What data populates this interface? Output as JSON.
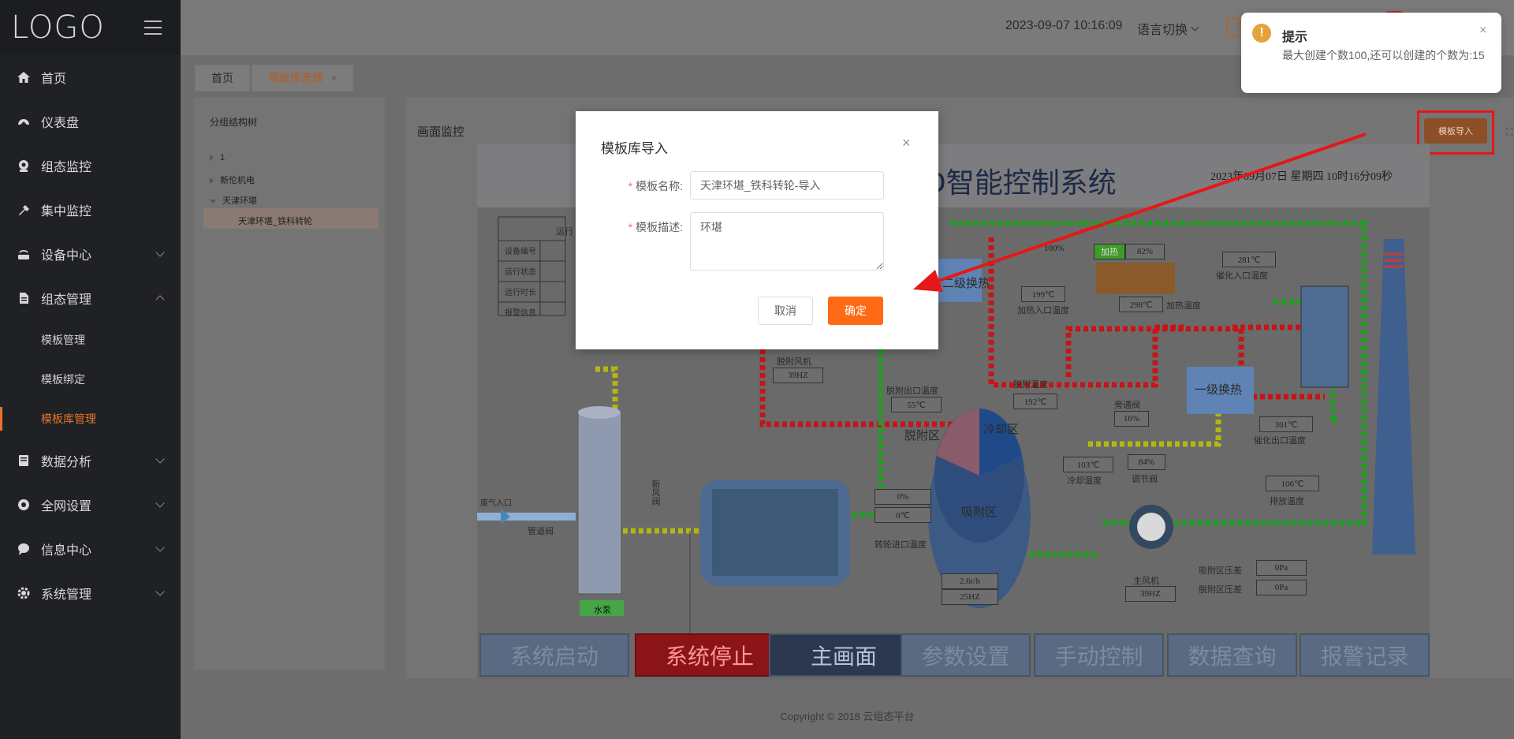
{
  "app": {
    "logo": "LOGO"
  },
  "header": {
    "datetime": "2023-09-07 10:16:09",
    "language_switch": "语言切换"
  },
  "sidebar": {
    "items": [
      {
        "label": "首页",
        "icon": "home-icon"
      },
      {
        "label": "仪表盘",
        "icon": "dashboard-icon"
      },
      {
        "label": "组态监控",
        "icon": "camera-icon"
      },
      {
        "label": "集中监控",
        "icon": "hammer-icon"
      },
      {
        "label": "设备中心",
        "icon": "router-icon"
      },
      {
        "label": "组态管理",
        "icon": "document-icon"
      },
      {
        "label": "数据分析",
        "icon": "report-icon"
      },
      {
        "label": "全网设置",
        "icon": "target-icon"
      },
      {
        "label": "信息中心",
        "icon": "chat-icon"
      },
      {
        "label": "系统管理",
        "icon": "gear-icon"
      }
    ],
    "submenu": [
      "模板管理",
      "模板绑定",
      "模板库管理"
    ]
  },
  "tabs": [
    {
      "label": "首页"
    },
    {
      "label": "模板库管理",
      "close": "×"
    }
  ],
  "tree": {
    "title": "分组结构树",
    "nodes": [
      "1",
      "新伦机电",
      "天津环堪",
      "天津环堪_铁科转轮"
    ]
  },
  "main": {
    "title": "画面监控",
    "import_button": "模板导入"
  },
  "scada": {
    "title": "D智能控制系统",
    "date": "2023年09月07日 星期四 10时16分09秒",
    "table_header": "运行",
    "table_rows": [
      "设备编号",
      "运行状态",
      "运行时长",
      "报警信息"
    ],
    "labels": {
      "exhaust_inlet": "废气入口",
      "pipe_valve": "管道阀",
      "water_pump": "水泵",
      "fresh_air_valve": "新风阀",
      "desorb_fan": "脱附风机",
      "desorb_fan_hz": "39HZ",
      "desorb_out_temp": "脱附出口温度",
      "desorb_out_val": "55℃",
      "desorb_temp": "脱附温度",
      "desorb_temp_val": "192℃",
      "desorb_zone": "脱附区",
      "cool_zone": "冷却区",
      "adsorb_zone": "吸附区",
      "hx2": "二级换热",
      "hx1": "一级换热",
      "v100": "100%",
      "heat_in_temp": "加热入口温度",
      "heat_in_val": "199℃",
      "heating": "加热",
      "heat_pct": "82%",
      "heat_temp": "加热温度",
      "heat_temp_val": "298℃",
      "cat_in_temp": "催化入口温度",
      "cat_in_val": "281℃",
      "bypass_valve": "旁通阀",
      "bypass_pct": "16%",
      "cool_temp": "冷却温度",
      "cool_temp_val": "103℃",
      "reg_valve": "调节阀",
      "reg_pct": "84%",
      "cat_out_temp": "催化出口温度",
      "cat_out_val": "301℃",
      "exhaust_temp": "排放温度",
      "exhaust_val": "106℃",
      "wheel_pct": "0%",
      "wheel_temp": "0℃",
      "wheel_in_temp": "转轮进口温度",
      "wheel_speed": "2.6r/h",
      "wheel_hz": "25HZ",
      "main_fan": "主风机",
      "main_fan_hz": "39HZ",
      "adsorb_dp": "吸附区压差",
      "adsorb_dp_val": "0Pa",
      "desorb_dp": "脱附区压差",
      "desorb_dp_val": "0Pa"
    },
    "buttons": [
      "系统启动",
      "系统停止",
      "主画面",
      "参数设置",
      "手动控制",
      "数据查询",
      "报警记录"
    ]
  },
  "footer": "Copyright © 2018 云组态平台",
  "modal": {
    "title": "模板库导入",
    "close": "×",
    "name_label": "模板名称:",
    "name_value": "天津环堪_铁科转轮-导入",
    "desc_label": "模板描述:",
    "desc_value": "环堪",
    "cancel": "取消",
    "confirm": "确定"
  },
  "notification": {
    "icon": "!",
    "title": "提示",
    "message": "最大创建个数100,还可以创建的个数为:15",
    "close": "×"
  },
  "colors": {
    "accent": "#ff6a16",
    "warning": "#e6a23c",
    "highlight": "#e61717",
    "sidebar_bg": "#1f2125"
  }
}
